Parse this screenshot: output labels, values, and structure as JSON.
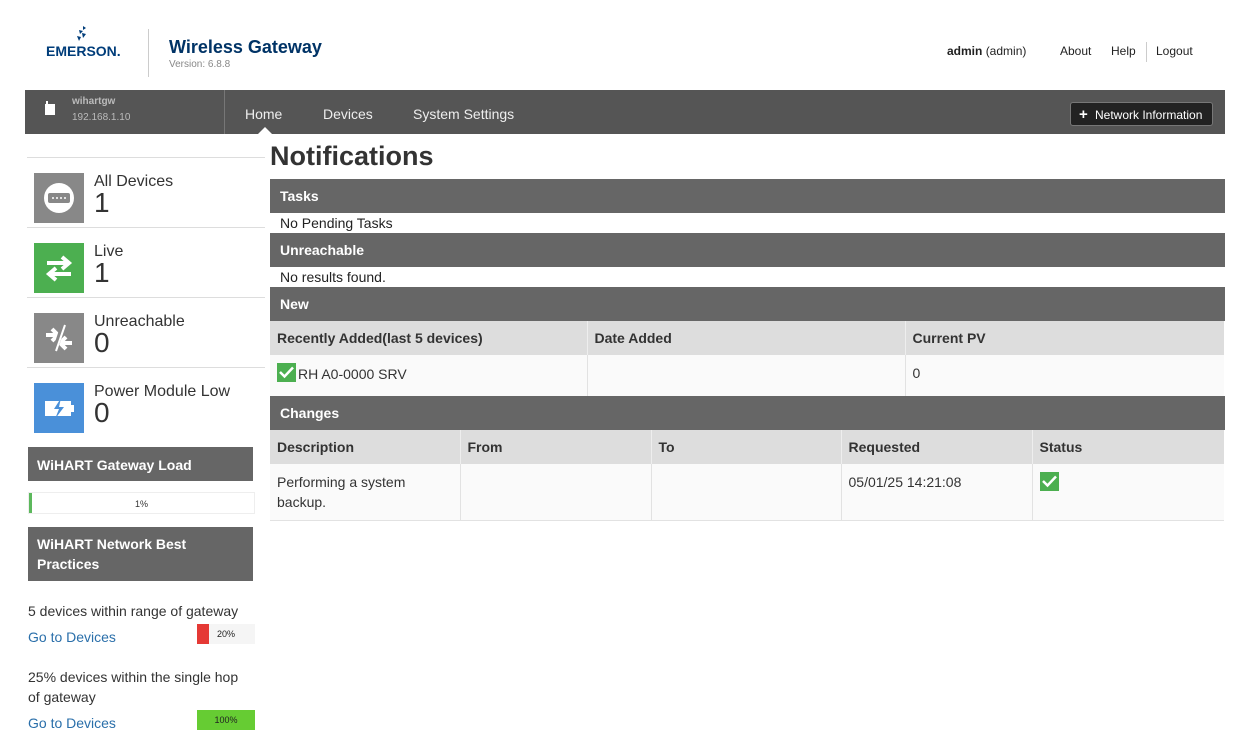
{
  "header": {
    "brand": "EMERSON.",
    "title": "Wireless Gateway",
    "version": "Version: 6.8.8",
    "user_name": "admin",
    "user_role": "(admin)",
    "about": "About",
    "help": "Help",
    "logout": "Logout"
  },
  "nav": {
    "gateway_name": "wihartgw",
    "gateway_ip": "192.168.1.10",
    "tabs": [
      "Home",
      "Devices",
      "System Settings"
    ],
    "active_tab": "Home",
    "network_info": "Network Information"
  },
  "sidebar": {
    "stats": [
      {
        "label": "All Devices",
        "count": "1",
        "color": "#888888",
        "icon": "device-icon"
      },
      {
        "label": "Live",
        "count": "1",
        "color": "#4caf50",
        "icon": "arrows-exchange-icon"
      },
      {
        "label": "Unreachable",
        "count": "0",
        "color": "#888888",
        "icon": "broken-link-icon"
      },
      {
        "label": "Power Module Low",
        "count": "0",
        "color": "#4a90d9",
        "icon": "battery-low-icon"
      }
    ],
    "load_title": "WiHART Gateway Load",
    "load_pct": "1%",
    "load_value": 0.01,
    "practices_title": "WiHART Network Best Practices",
    "practices": [
      {
        "text": "5 devices within range of gateway",
        "link": "Go to Devices",
        "pct": "20%",
        "value": 0.2,
        "color": "#e53935"
      },
      {
        "text": "25% devices within the single hop of gateway",
        "link": "Go to Devices",
        "pct": "100%",
        "value": 1.0,
        "color": "#66cc33"
      }
    ]
  },
  "main": {
    "title": "Notifications",
    "tasks_title": "Tasks",
    "tasks_text": "No Pending Tasks",
    "unreachable_title": "Unreachable",
    "unreachable_text": "No results found.",
    "new_title": "New",
    "new_columns": [
      "Recently Added(last 5 devices)",
      "Date Added",
      "Current PV"
    ],
    "new_rows": [
      {
        "device": "RH A0-0000 SRV",
        "date": "",
        "pv": "0"
      }
    ],
    "changes_title": "Changes",
    "changes_columns": [
      "Description",
      "From",
      "To",
      "Requested",
      "Status"
    ],
    "changes_rows": [
      {
        "description": "Performing a system backup.",
        "from": "",
        "to": "",
        "requested": "05/01/25 14:21:08",
        "status": "complete"
      }
    ]
  }
}
